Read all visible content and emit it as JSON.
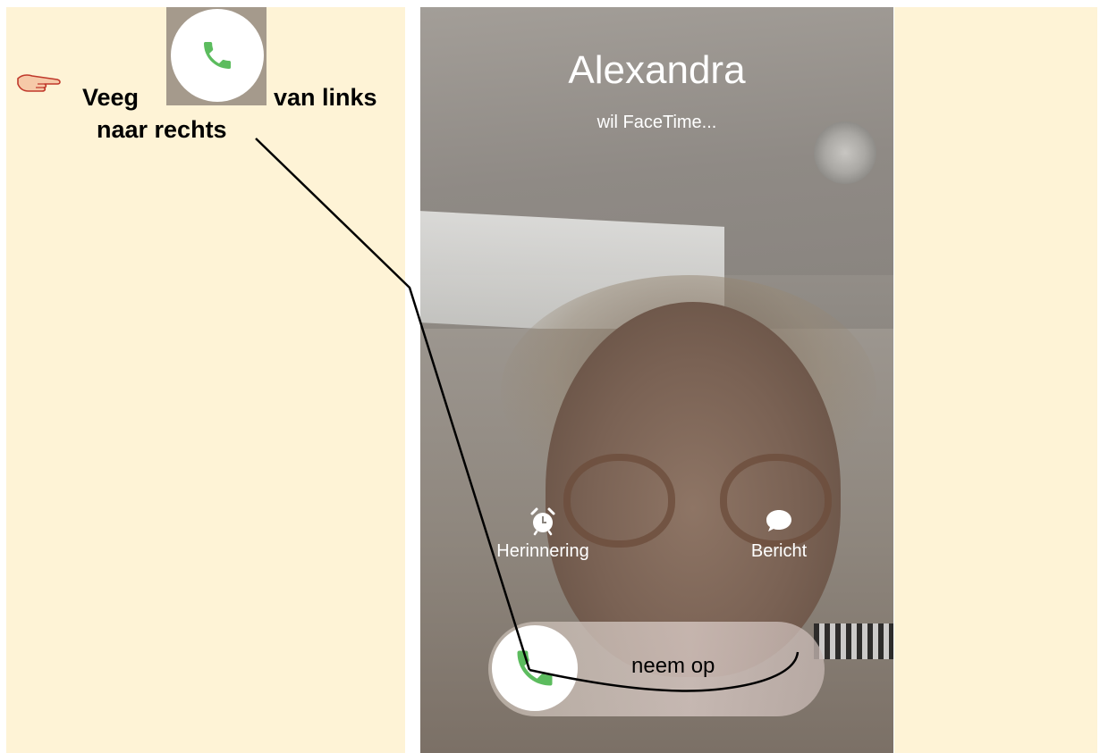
{
  "instruction": {
    "word1": "Veeg",
    "word2": "van links",
    "line2": "naar rechts"
  },
  "call": {
    "caller": "Alexandra",
    "status": "wil FaceTime..."
  },
  "actions": {
    "remind": "Herinnering",
    "message": "Bericht"
  },
  "slider": {
    "label": "neem op"
  },
  "icons": {
    "pointer": "hand-pointer-icon",
    "phone": "phone-icon",
    "alarm": "alarm-clock-icon",
    "message": "speech-bubble-icon"
  },
  "colors": {
    "panel_bg": "#fef3d6",
    "phone_green": "#5cbc5e",
    "pointer_fill": "#f6c9a8",
    "pointer_stroke": "#c0392b"
  }
}
